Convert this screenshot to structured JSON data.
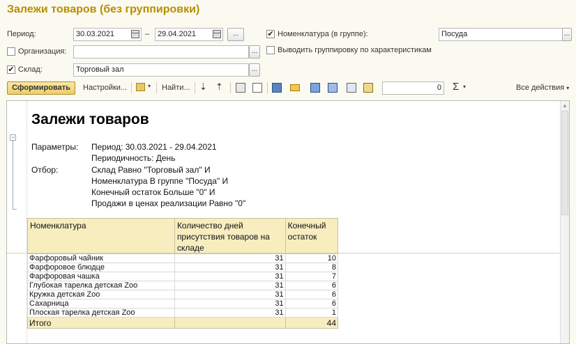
{
  "title": "Залежи товаров (без группировки)",
  "form": {
    "period_label": "Период:",
    "date_from": "30.03.2021",
    "date_dash": "–",
    "date_to": "29.04.2021",
    "ellipsis": "...",
    "nomenclature_label": "Номенклатура (в группе):",
    "nomenclature_value": "Посуда",
    "nomenclature_checked": "✔",
    "org_label": "Организация:",
    "org_value": "",
    "group_by_chars_label": "Выводить группировку по характеристикам",
    "warehouse_label": "Склад:",
    "warehouse_checked": "✔",
    "warehouse_value": "Торговый зал"
  },
  "toolbar": {
    "generate": "Сформировать",
    "settings": "Настройки...",
    "find": "Найти...",
    "sum_value": "0",
    "sigma": "Σ",
    "all_actions": "Все действия"
  },
  "report": {
    "title": "Залежи товаров",
    "params_label": "Параметры:",
    "period_line": "Период: 30.03.2021 - 29.04.2021",
    "periodicity_line": "Периодичность: День",
    "filter_label": "Отбор:",
    "filter_lines": [
      "Склад Равно \"Торговый зал\" И",
      "Номенклатура В группе \"Посуда\" И",
      "Конечный остаток Больше \"0\" И",
      "Продажи в ценах реализации Равно \"0\""
    ],
    "columns": [
      "Номенклатура",
      "Количество дней присутствия товаров на складе",
      "Конечный остаток"
    ],
    "rows": [
      {
        "name": "Фарфоровый чайник",
        "days": "31",
        "rest": "10"
      },
      {
        "name": "Фарфоровое блюдце",
        "days": "31",
        "rest": "8"
      },
      {
        "name": "Фарфоровая чашка",
        "days": "31",
        "rest": "7"
      },
      {
        "name": "Глубокая тарелка детская Zoo",
        "days": "31",
        "rest": "6"
      },
      {
        "name": "Кружка детская Zoo",
        "days": "31",
        "rest": "6"
      },
      {
        "name": "Сахарница",
        "days": "31",
        "rest": "6"
      },
      {
        "name": "Плоская тарелка детская Zoo",
        "days": "31",
        "rest": "1"
      }
    ],
    "total_label": "Итого",
    "total_value": "44"
  }
}
